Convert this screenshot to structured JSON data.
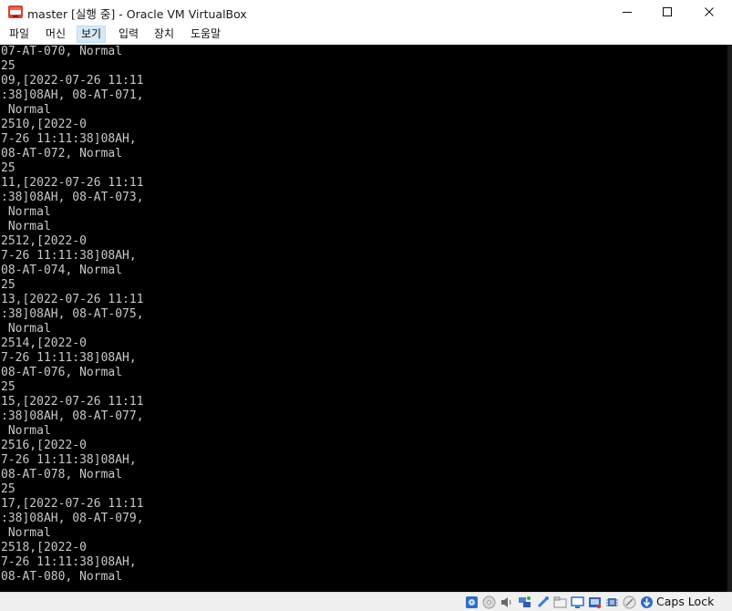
{
  "window": {
    "title": "master [실행 중] - Oracle VM VirtualBox"
  },
  "menu": {
    "items": [
      "파일",
      "머신",
      "보기",
      "입력",
      "장치",
      "도움말"
    ],
    "active_index": 2
  },
  "terminal": {
    "lines": [
      "07-AT-070, Normal",
      "25",
      "09,[2022-07-26 11:11",
      ":38]08AH, 08-AT-071,",
      " Normal",
      "2510,[2022-0",
      "7-26 11:11:38]08AH,",
      "08-AT-072, Normal",
      "25",
      "11,[2022-07-26 11:11",
      ":38]08AH, 08-AT-073,",
      " Normal",
      " Normal",
      "2512,[2022-0",
      "7-26 11:11:38]08AH,",
      "08-AT-074, Normal",
      "25",
      "13,[2022-07-26 11:11",
      ":38]08AH, 08-AT-075,",
      " Normal",
      "2514,[2022-0",
      "7-26 11:11:38]08AH,",
      "08-AT-076, Normal",
      "25",
      "15,[2022-07-26 11:11",
      ":38]08AH, 08-AT-077,",
      " Normal",
      "2516,[2022-0",
      "7-26 11:11:38]08AH,",
      "08-AT-078, Normal",
      "25",
      "17,[2022-07-26 11:11",
      ":38]08AH, 08-AT-079,",
      " Normal",
      "2518,[2022-0",
      "7-26 11:11:38]08AH,",
      "08-AT-080, Normal"
    ]
  },
  "statusbar": {
    "icons": [
      "hard-disk-icon",
      "optical-drive-icon",
      "audio-icon",
      "network-icon",
      "usb-icon",
      "shared-folder-icon",
      "display-icon",
      "video-capture-icon",
      "cpu-icon",
      "mouse-integration-icon",
      "keyboard-capture-icon"
    ],
    "caps_lock_label": "Caps Lock"
  },
  "colors": {
    "screen_bg": "#000000",
    "terminal_text": "#c8c8c8",
    "menu_highlight": "#d7e9f7",
    "statusbar_bg": "#f0f0f0"
  }
}
